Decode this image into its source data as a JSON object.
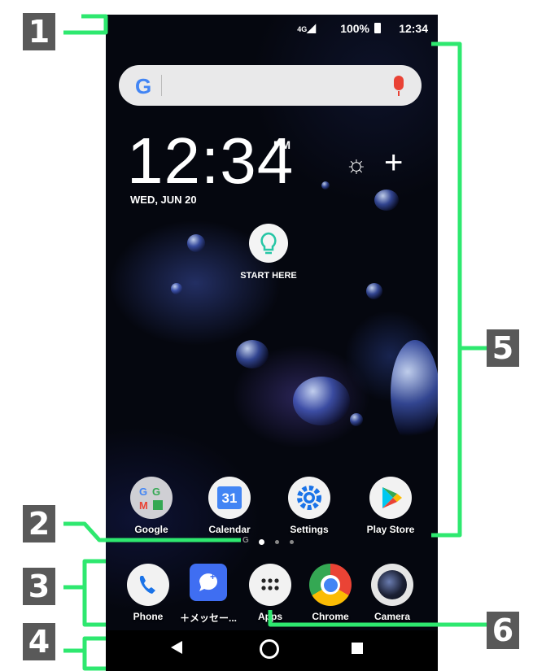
{
  "status_bar": {
    "network": "4G",
    "battery": "100%",
    "time": "12:34"
  },
  "search": {
    "logo": "G"
  },
  "clock": {
    "time": "12:34",
    "ampm": "PM",
    "date": "WED, JUN 20"
  },
  "weather": {
    "symbol": "☼",
    "add": "+"
  },
  "start_here": {
    "label": "START HERE"
  },
  "home_apps": [
    {
      "label": "Google"
    },
    {
      "label": "Calendar",
      "date": "31"
    },
    {
      "label": "Settings"
    },
    {
      "label": "Play Store"
    }
  ],
  "page_indicator": {
    "g": "G"
  },
  "dock_apps": [
    {
      "label": "Phone"
    },
    {
      "label": "＋メッセー..."
    },
    {
      "label": "Apps"
    },
    {
      "label": "Chrome"
    },
    {
      "label": "Camera"
    }
  ],
  "callouts": [
    "1",
    "2",
    "3",
    "4",
    "5",
    "6"
  ],
  "colors": {
    "callout_line": "#2ee86f",
    "callout_box": "#595959",
    "screen_bg": "#05070f"
  }
}
